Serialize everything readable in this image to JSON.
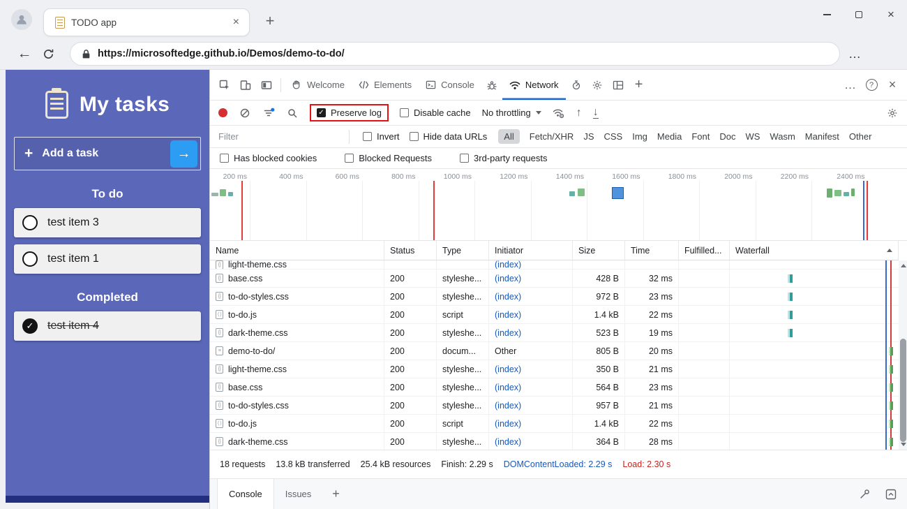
{
  "window": {
    "tab_title": "TODO app",
    "url": "https://microsoftedge.github.io/Demos/demo-to-do/"
  },
  "icons": {
    "plus": "+",
    "arrow_right": "→",
    "check": "✓",
    "close": "×",
    "back_arrow": "←",
    "ellipsis": "…",
    "up_arrow": "↑",
    "down_arrow": "↓",
    "question": "?"
  },
  "colors": {
    "todo_purple": "#5b67b8",
    "accent_blue": "#2368ce",
    "highlight_red": "#e31212",
    "link_blue": "#1958b7",
    "load_red": "#c5221f",
    "dcl_blue": "#3668c9"
  },
  "todo": {
    "title": "My tasks",
    "add_task": "Add a task",
    "sections": [
      {
        "label": "To do",
        "items": [
          {
            "text": "test item 3",
            "done": false
          },
          {
            "text": "test item 1",
            "done": false
          }
        ]
      },
      {
        "label": "Completed",
        "items": [
          {
            "text": "test item 4",
            "done": true
          }
        ]
      }
    ]
  },
  "devtools": {
    "tabs": {
      "welcome": "Welcome",
      "elements": "Elements",
      "console": "Console",
      "network": "Network"
    },
    "toolbar": {
      "preserve_log": "Preserve log",
      "disable_cache": "Disable cache",
      "throttling": "No throttling"
    },
    "filterbar": {
      "filter_placeholder": "Filter",
      "invert": "Invert",
      "hide_data_urls": "Hide data URLs",
      "chips": [
        "All",
        "Fetch/XHR",
        "JS",
        "CSS",
        "Img",
        "Media",
        "Font",
        "Doc",
        "WS",
        "Wasm",
        "Manifest",
        "Other"
      ],
      "selected_chip": "All",
      "row2": [
        "Has blocked cookies",
        "Blocked Requests",
        "3rd-party requests"
      ]
    },
    "timeline_ticks": [
      "200 ms",
      "400 ms",
      "600 ms",
      "800 ms",
      "1000 ms",
      "1200 ms",
      "1400 ms",
      "1600 ms",
      "1800 ms",
      "2000 ms",
      "2200 ms",
      "2400 ms"
    ],
    "table": {
      "columns": [
        "Name",
        "Status",
        "Type",
        "Initiator",
        "Size",
        "Time",
        "Fulfilled...",
        "Waterfall"
      ],
      "rows": [
        {
          "partial": true,
          "icon": "css",
          "name": "light-theme.css",
          "status": "",
          "type": "",
          "initiator": "(index)",
          "size": "",
          "time": "",
          "wf": ""
        },
        {
          "icon": "css",
          "name": "base.css",
          "status": "200",
          "type": "styleshe...",
          "initiator": "(index)",
          "size": "428 B",
          "time": "32 ms",
          "wf": "early"
        },
        {
          "icon": "css",
          "name": "to-do-styles.css",
          "status": "200",
          "type": "styleshe...",
          "initiator": "(index)",
          "size": "972 B",
          "time": "23 ms",
          "wf": "early"
        },
        {
          "icon": "js",
          "name": "to-do.js",
          "status": "200",
          "type": "script",
          "initiator": "(index)",
          "size": "1.4 kB",
          "time": "22 ms",
          "wf": "early"
        },
        {
          "icon": "css",
          "name": "dark-theme.css",
          "status": "200",
          "type": "styleshe...",
          "initiator": "(index)",
          "size": "523 B",
          "time": "19 ms",
          "wf": "early"
        },
        {
          "icon": "doc",
          "name": "demo-to-do/",
          "status": "200",
          "type": "docum...",
          "initiator": "Other",
          "size": "805 B",
          "time": "20 ms",
          "wf": "late"
        },
        {
          "icon": "css",
          "name": "light-theme.css",
          "status": "200",
          "type": "styleshe...",
          "initiator": "(index)",
          "size": "350 B",
          "time": "21 ms",
          "wf": "late"
        },
        {
          "icon": "css",
          "name": "base.css",
          "status": "200",
          "type": "styleshe...",
          "initiator": "(index)",
          "size": "564 B",
          "time": "23 ms",
          "wf": "late"
        },
        {
          "icon": "css",
          "name": "to-do-styles.css",
          "status": "200",
          "type": "styleshe...",
          "initiator": "(index)",
          "size": "957 B",
          "time": "21 ms",
          "wf": "late"
        },
        {
          "icon": "js",
          "name": "to-do.js",
          "status": "200",
          "type": "script",
          "initiator": "(index)",
          "size": "1.4 kB",
          "time": "22 ms",
          "wf": "late"
        },
        {
          "icon": "css",
          "name": "dark-theme.css",
          "status": "200",
          "type": "styleshe...",
          "initiator": "(index)",
          "size": "364 B",
          "time": "28 ms",
          "wf": "late"
        }
      ]
    },
    "summary": {
      "requests": "18 requests",
      "transferred": "13.8 kB transferred",
      "resources": "25.4 kB resources",
      "finish": "Finish: 2.29 s",
      "dcl": "DOMContentLoaded: 2.29 s",
      "load": "Load: 2.30 s"
    },
    "drawer": {
      "tabs": [
        "Console",
        "Issues"
      ]
    }
  }
}
